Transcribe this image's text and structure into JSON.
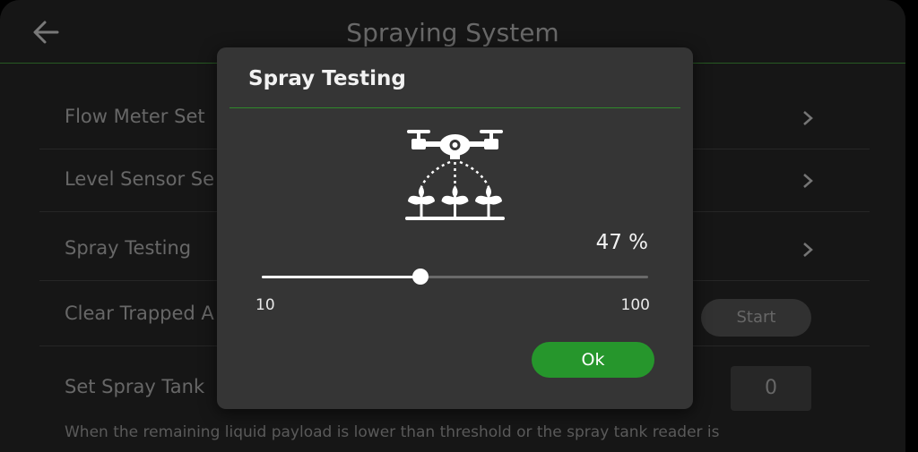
{
  "header": {
    "title": "Spraying System",
    "back_icon": "arrow-left-icon"
  },
  "settings": {
    "rows": [
      {
        "label": "Flow Meter Set"
      },
      {
        "label": "Level Sensor Se"
      },
      {
        "label": "Spray Testing"
      },
      {
        "label": "Clear Trapped A"
      },
      {
        "label": "Set Spray Tank"
      }
    ],
    "start_label": "Start",
    "tank_value": "0",
    "note": "When the remaining liquid payload is lower than threshold or the spray tank reader is"
  },
  "dialog": {
    "title": "Spray Testing",
    "icon": "drone-spraying-plants-icon",
    "value_text": "47 %",
    "slider": {
      "min_label": "10",
      "max_label": "100",
      "min": 10,
      "max": 100,
      "value": 47
    },
    "ok_label": "Ok"
  },
  "colors": {
    "accent": "#26962c",
    "divider": "#2f8a2a",
    "dialog_bg": "#353535",
    "screen_bg": "#1b1b1b"
  }
}
